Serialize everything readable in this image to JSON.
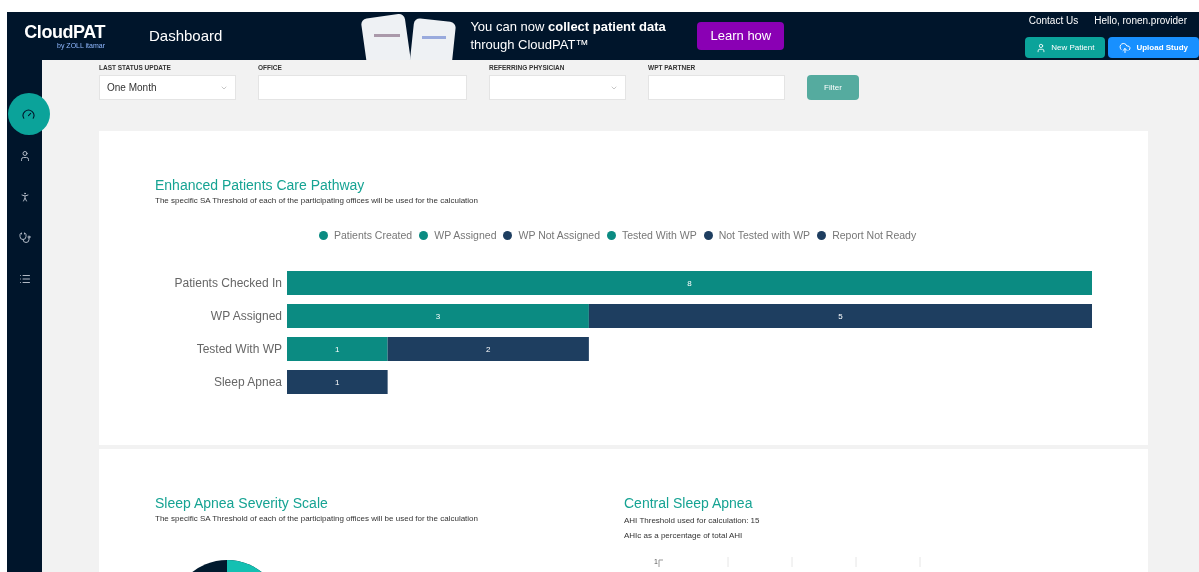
{
  "header": {
    "logo": "CloudPAT",
    "logo_sub": "by ZOLL itamar",
    "title": "Dashboard",
    "promo": {
      "text": "You can now **collect patient data** through CloudPAT™",
      "button": "Learn how"
    },
    "contact": "Contact Us",
    "greeting": "Hello, ronen.provider",
    "buttons": [
      {
        "kind": "new",
        "label": "New Patient"
      },
      {
        "kind": "upload",
        "label": "Upload Study"
      }
    ]
  },
  "sidebar": {
    "items": [
      {
        "selected": true
      },
      {
        "selected": false
      },
      {
        "selected": false
      },
      {
        "selected": false
      },
      {
        "selected": false
      }
    ]
  },
  "filters": [
    {
      "kind": "select",
      "label": "LAST STATUS UPDATE",
      "value": "One Month"
    },
    {
      "kind": "input",
      "label": "OFFICE"
    },
    {
      "kind": "select",
      "label": "REFERRING PHYSICIAN"
    },
    {
      "kind": "input",
      "label": "WPT PARTNER"
    }
  ],
  "filter_button": "Filter",
  "pathway": {
    "title": "Enhanced Patients Care Pathway",
    "subtitle": "The specific SA Threshold of each of the participating offices will be used for the calculation",
    "chart_data": {
      "type": "bar",
      "orientation": "horizontal",
      "stacked": true,
      "data_labels": true,
      "categories": [
        "Patients Checked In",
        "WP Assigned",
        "Tested With WP",
        "Sleep Apnea"
      ],
      "series": [
        {
          "name": "Patients Created",
          "color": "#0b8b82",
          "values": [
            8,
            null,
            null,
            null
          ]
        },
        {
          "name": "WP Assigned",
          "color": "#0b8b82",
          "values": [
            null,
            3,
            null,
            null
          ]
        },
        {
          "name": "WP Not Assigned",
          "color": "#1e3e60",
          "values": [
            null,
            5,
            null,
            null
          ]
        },
        {
          "name": "Tested With WP",
          "color": "#0b8b82",
          "values": [
            null,
            null,
            1,
            null
          ]
        },
        {
          "name": "Not Tested with WP",
          "color": "#1e3e60",
          "values": [
            null,
            null,
            2,
            null
          ]
        },
        {
          "name": "Report Not Ready",
          "color": "#1e3e60",
          "values": [
            null,
            null,
            null,
            1
          ]
        }
      ]
    }
  },
  "severity": {
    "title": "Sleep Apnea Severity Scale",
    "subtitle": "The specific SA Threshold of each of the participating offices will be used for the calculation"
  },
  "central": {
    "title": "Central Sleep Apnea",
    "lines": [
      "AHI Threshold used for calculation: 15",
      "AHIc as a percentage of total AHI"
    ],
    "axis_tick": "1"
  }
}
